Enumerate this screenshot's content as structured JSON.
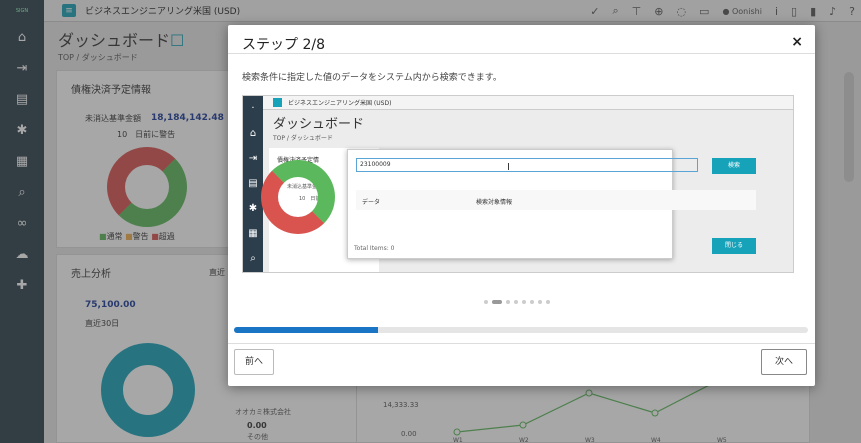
{
  "app": {
    "company": "ビジネスエンジニアリング米国 (USD)",
    "logo_text": "SIGN",
    "username": "Oonishi"
  },
  "page": {
    "title": "ダッシュボード",
    "breadcrumb": "TOP / ダッシュボード"
  },
  "panels": {
    "bond": {
      "title": "債権決済予定情報",
      "label": "未消込基準金額",
      "amount": "18,184,142.48",
      "warning": "10　日前に警告",
      "legend": [
        "通常",
        "警告",
        "超過"
      ]
    },
    "sales": {
      "title": "売上分析",
      "sub": "直近",
      "amount": "75,100.00",
      "period": "直近30日",
      "legend_company": "オオカミ株式会社",
      "legend_other_value": "0.00",
      "legend_other": "その他"
    },
    "chart": {
      "y_labels": [
        "14,333.33",
        "0.00"
      ],
      "x_labels": [
        "W1",
        "W2",
        "W3",
        "W4",
        "W5"
      ]
    }
  },
  "modal": {
    "title": "ステップ 2/8",
    "close": "×",
    "description": "検索条件に指定した値のデータをシステム内から検索できます。",
    "progress": 0.25,
    "prev": "前へ",
    "next": "次へ",
    "dots_count": 8,
    "dots_active": 1
  },
  "inner_shot": {
    "company": "ビジネスエンジニアリング米国 (USD)",
    "title": "ダッシュボード",
    "breadcrumb": "TOP / ダッシュボード",
    "panel_title": "債権決済予定情",
    "panel_label": "未消込基準金額",
    "panel_warn": "10　日前",
    "search_value": "23100009",
    "search_btn": "検索",
    "col_data": "データ",
    "col_info": "検索対象情報",
    "total": "Total Items: 0",
    "close_btn": "閉じる"
  }
}
